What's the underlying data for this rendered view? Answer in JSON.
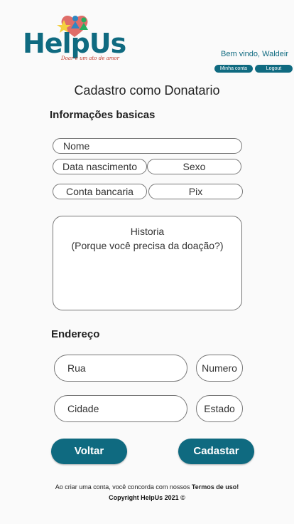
{
  "header": {
    "logo_text": "HelpUs",
    "logo_tagline": "Doar é um ato de amor",
    "welcome": "Bem vindo, Waldeir",
    "account_label": "Minha conta",
    "logout_label": "Logout"
  },
  "page_title": "Cadastro como Donatario",
  "basic_info": {
    "heading": "Informações basicas",
    "name_placeholder": "Nome",
    "birthdate_placeholder": "Data nascimento",
    "sex_placeholder": "Sexo",
    "bank_account_placeholder": "Conta bancaria",
    "pix_placeholder": "Pix",
    "history_line1": "Historia",
    "history_line2": "(Porque você precisa da doação?)"
  },
  "address": {
    "heading": "Endereço",
    "street_placeholder": "Rua",
    "number_placeholder": "Numero",
    "city_placeholder": "Cidade",
    "state_placeholder": "Estado"
  },
  "actions": {
    "back_label": "Voltar",
    "submit_label": "Cadastar"
  },
  "footer": {
    "terms_prefix": "Ao criar uma conta, você concorda com nossos",
    "terms_link": "Termos de uso!",
    "copyright": "Copyright HelpUs 2021 ©"
  },
  "colors": {
    "brand": "#0f6a80",
    "accent": "#c0392b"
  }
}
